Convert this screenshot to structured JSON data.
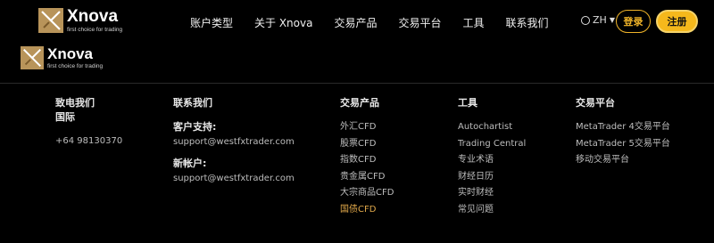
{
  "brand": {
    "name": "Xnova",
    "tagline": "first choice for trading"
  },
  "nav": [
    "账户类型",
    "关于 Xnova",
    "交易产品",
    "交易平台",
    "工具",
    "联系我们"
  ],
  "lang": {
    "code": "ZH"
  },
  "auth": {
    "login": "登录",
    "register": "注册"
  },
  "footer": {
    "contact_col": {
      "title_line1": "致电我们",
      "title_line2": "国际",
      "phone": "+64 98130370"
    },
    "email_col": {
      "title": "联系我们",
      "support_label": "客户支持:",
      "support_email": "support@westfxtrader.com",
      "new_account_label": "新帐户:",
      "new_account_email": "support@westfxtrader.com"
    },
    "products": {
      "title": "交易产品",
      "items": [
        "外汇CFD",
        "股票CFD",
        "指数CFD",
        "贵金属CFD",
        "大宗商品CFD",
        "国债CFD"
      ]
    },
    "tools": {
      "title": "工具",
      "items": [
        "Autochartist",
        "Trading Central",
        "专业术语",
        "财经日历",
        "实时财经",
        "常见问题"
      ]
    },
    "platforms": {
      "title": "交易平台",
      "items": [
        "MetaTrader 4交易平台",
        "MetaTrader 5交易平台",
        "移动交易平台"
      ]
    }
  },
  "colors": {
    "accent": "#f5b81c",
    "highlight": "#e0a84a",
    "logo_bg": "#b8945a"
  }
}
